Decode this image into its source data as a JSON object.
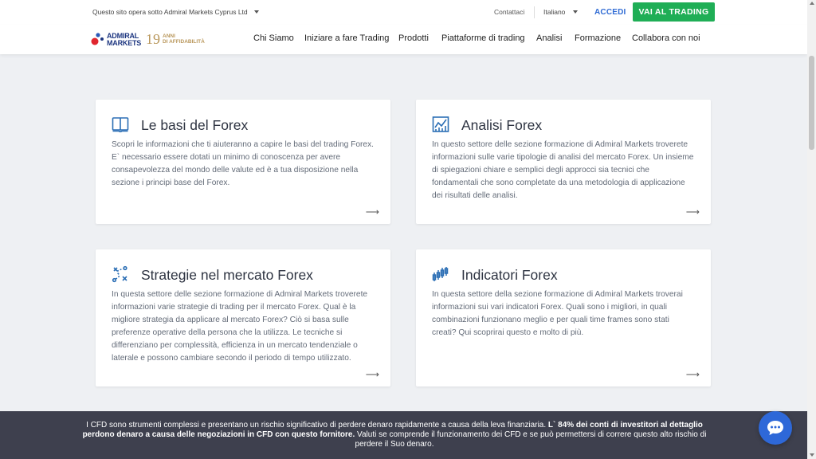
{
  "topbar": {
    "entity": "Questo sito opera sotto Admiral Markets Cyprus Ltd",
    "contact": "Contattaci",
    "language": "Italiano",
    "login": "ACCEDI",
    "cta": "VAI AL TRADING"
  },
  "logo": {
    "line1": "ADMIRAL",
    "line2": "MARKETS",
    "years": "19",
    "years_line1": "ANNI",
    "years_line2": "DI AFFIDABILITÀ"
  },
  "nav": {
    "items": [
      "Chi Siamo",
      "Iniziare a fare Trading",
      "Prodotti",
      "Piattaforme di trading",
      "Analisi",
      "Formazione",
      "Collabora con noi"
    ]
  },
  "cards": [
    {
      "icon": "book-icon",
      "title": "Le basi del Forex",
      "text": "Scopri le informazioni che ti aiuteranno a capire le basi del trading Forex. E` necessario essere dotati un minimo di conoscenza per avere consapevolezza del mondo delle valute ed è a tua disposizione nella sezione i principi base del Forex."
    },
    {
      "icon": "chart-icon",
      "title": "Analisi Forex",
      "text": "In questo settore delle sezione formazione di Admiral Markets troverete informazioni sulle varie tipologie di analisi del mercato Forex. Un insieme di spiegazioni chiare e semplici degli approcci sia tecnici che fondamentali che sono completate da una metodologia di applicazione dei risultati delle analisi."
    },
    {
      "icon": "strategy-icon",
      "title": "Strategie nel mercato Forex",
      "text": "In questa settore delle sezione formazione di Admiral Markets troverete informazioni varie strategie di trading per il mercato Forex. Qual è la migliore strategia da applicare al mercato Forex? Ciò si basa sulle preferenze operative della persona che la utilizza. Le tecniche si differenziano per complessità, efficienza in un mercato tendenziale o laterale e possono cambiare secondo il periodo di tempo utilizzato."
    },
    {
      "icon": "candlestick-icon",
      "title": "Indicatori Forex",
      "text": "In questa settore della sezione formazione di Admiral Markets troverai informazioni sui vari indicatori Forex. Quali sono i migliori, in quali combinazioni funzionano meglio e per quali time frames sono stati creati? Qui scoprirai questo e molto di più."
    }
  ],
  "risk": {
    "part1": "I CFD sono strumenti complessi e presentano un rischio significativo di perdere denaro rapidamente a causa della leva finanziaria. ",
    "part2": "L` 84% dei conti di investitori al dettaglio perdono denaro a causa delle negoziazioni in CFD con questo fornitore.",
    "part3": " Valuti se comprende il funzionamento dei CFD e se può permettersi di correre questo alto rischio di perdere il Suo denaro."
  },
  "colors": {
    "accent_blue": "#2f6bd4",
    "cta_green": "#1fae56",
    "icon_blue": "#2c6fb5",
    "logo_gold": "#b9975b"
  }
}
